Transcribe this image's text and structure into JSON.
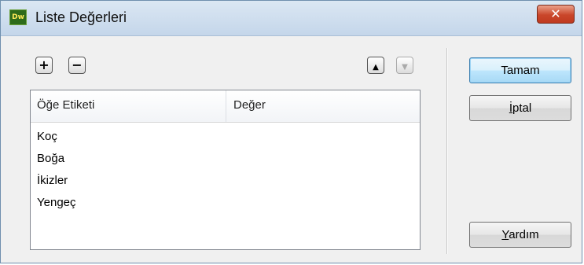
{
  "window": {
    "app_icon_text": "Dw",
    "title": "Liste Değerleri",
    "close_label": "✕"
  },
  "toolbar": {
    "add_label": "+",
    "remove_label": "−",
    "move_up_label": "▲",
    "move_down_label": "▼"
  },
  "list": {
    "columns": [
      "Öğe Etiketi",
      "Değer"
    ],
    "rows": [
      {
        "label": "Koç",
        "value": ""
      },
      {
        "label": "Boğa",
        "value": ""
      },
      {
        "label": "İkizler",
        "value": ""
      },
      {
        "label": "Yengeç",
        "value": ""
      }
    ]
  },
  "buttons": {
    "ok": "Tamam",
    "cancel_mnemonic": "İ",
    "cancel_rest": "ptal",
    "help_mnemonic": "Y",
    "help_rest": "ardım"
  },
  "colors": {
    "title_bar": "#c4d6ea",
    "close_button": "#c9462a",
    "default_button": "#bee6fd"
  },
  "icons": [
    "dreamweaver-app-icon",
    "close-icon",
    "plus-icon",
    "minus-icon",
    "arrow-up-icon",
    "arrow-down-icon"
  ]
}
